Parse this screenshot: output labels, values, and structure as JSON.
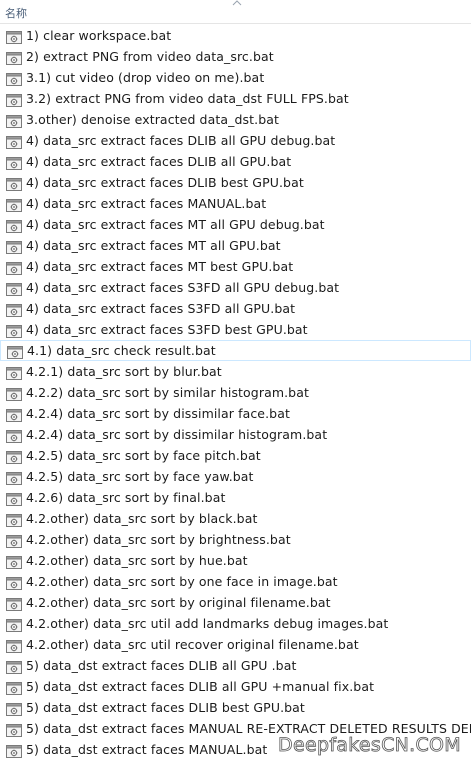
{
  "header": {
    "name_column": "名称",
    "sort_icon": "chevron-up-icon"
  },
  "file_icon": "batch-file-icon",
  "files": [
    "1) clear workspace.bat",
    "2) extract PNG from video data_src.bat",
    "3.1) cut video (drop video on me).bat",
    "3.2) extract PNG from video data_dst FULL FPS.bat",
    "3.other) denoise extracted data_dst.bat",
    "4) data_src extract faces DLIB all GPU debug.bat",
    "4) data_src extract faces DLIB all GPU.bat",
    "4) data_src extract faces DLIB best GPU.bat",
    "4) data_src extract faces MANUAL.bat",
    "4) data_src extract faces MT all GPU debug.bat",
    "4) data_src extract faces MT all GPU.bat",
    "4) data_src extract faces MT best GPU.bat",
    "4) data_src extract faces S3FD all GPU debug.bat",
    "4) data_src extract faces S3FD all GPU.bat",
    "4) data_src extract faces S3FD best GPU.bat",
    "4.1) data_src check result.bat",
    "4.2.1) data_src sort by blur.bat",
    "4.2.2) data_src sort by similar histogram.bat",
    "4.2.4) data_src sort by dissimilar face.bat",
    "4.2.4) data_src sort by dissimilar histogram.bat",
    "4.2.5) data_src sort by face pitch.bat",
    "4.2.5) data_src sort by face yaw.bat",
    "4.2.6) data_src sort by final.bat",
    "4.2.other) data_src sort by black.bat",
    "4.2.other) data_src sort by brightness.bat",
    "4.2.other) data_src sort by hue.bat",
    "4.2.other) data_src sort by one face in image.bat",
    "4.2.other) data_src sort by original filename.bat",
    "4.2.other) data_src util add landmarks debug images.bat",
    "4.2.other) data_src util recover original filename.bat",
    "5) data_dst extract faces DLIB all GPU .bat",
    "5) data_dst extract faces DLIB all GPU +manual fix.bat",
    "5) data_dst extract faces DLIB best GPU.bat",
    "5) data_dst extract faces MANUAL RE-EXTRACT DELETED RESULTS DEBU...",
    "5) data_dst extract faces MANUAL.bat"
  ],
  "selected_index": 15,
  "watermark": "DeepfakesCN.COM",
  "colors": {
    "selection_border": "#cce8ff",
    "header_text": "#4c607a"
  }
}
